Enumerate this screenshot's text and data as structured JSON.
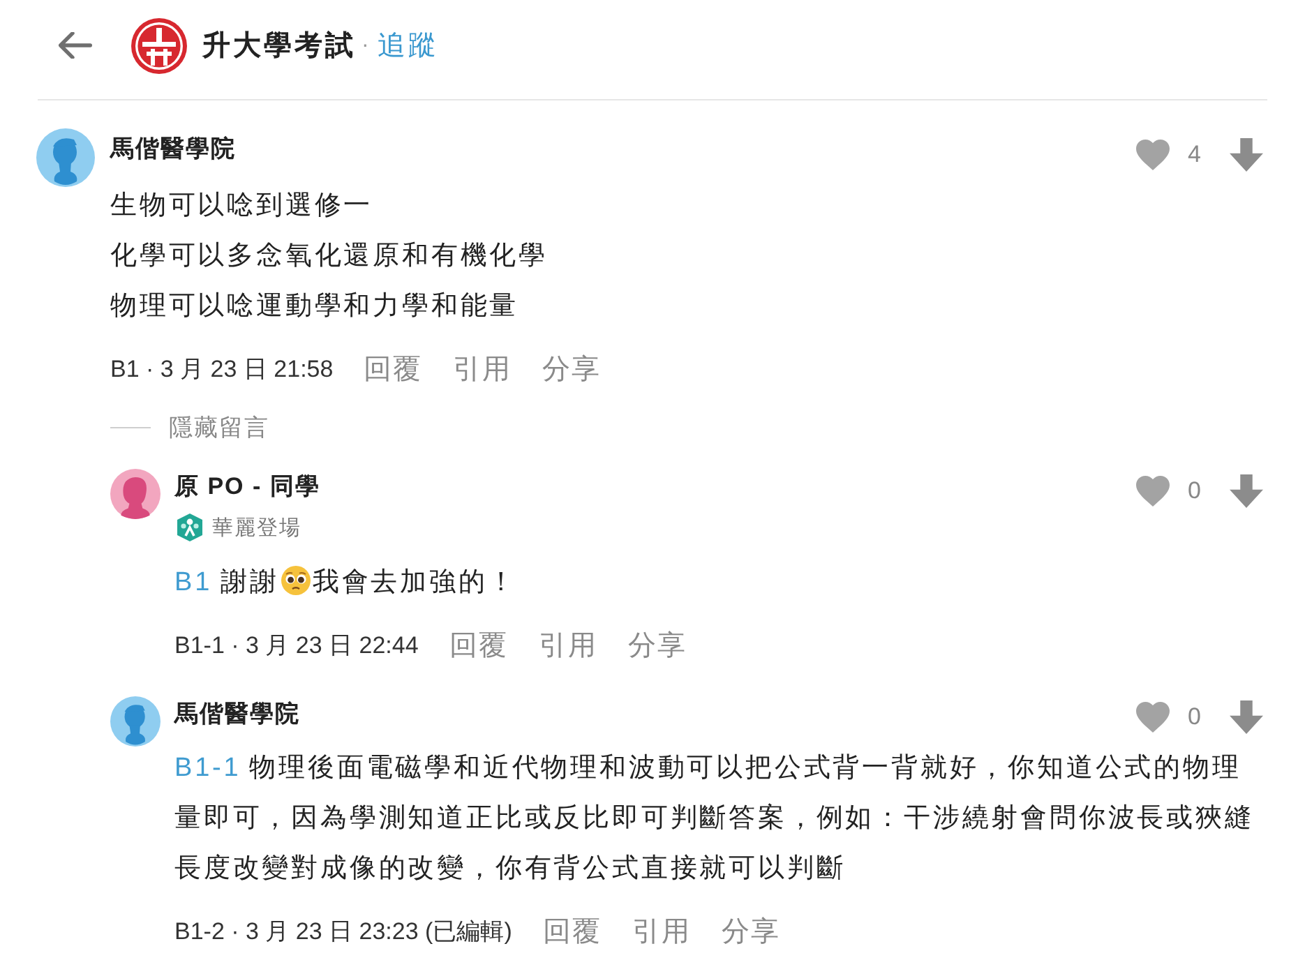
{
  "header": {
    "title": "升大學考試",
    "separator": "·",
    "follow": "追蹤"
  },
  "comments": [
    {
      "author": "馬偕醫學院",
      "avatar": {
        "kind": "male"
      },
      "liked": false,
      "likes": "4",
      "body": [
        [
          {
            "kind": "text",
            "text": "生物可以唸到選修一"
          }
        ],
        [
          {
            "kind": "text",
            "text": "化學可以多念氧化還原和有機化學"
          }
        ],
        [
          {
            "kind": "text",
            "text": "物理可以唸運動學和力學和能量"
          }
        ]
      ],
      "meta": "B1 · 3 月 23 日 21:58",
      "actions": [
        "回覆",
        "引用",
        "分享"
      ],
      "hidden_toggle": "隱藏留言",
      "replies": [
        {
          "author": "原 PO - 同學",
          "avatar": {
            "kind": "female"
          },
          "badge": "華麗登場",
          "liked": false,
          "likes": "0",
          "body": [
            [
              {
                "kind": "ref",
                "text": "B1"
              },
              {
                "kind": "text",
                "text": "謝謝"
              },
              {
                "kind": "emoji"
              },
              {
                "kind": "text",
                "text": "我會去加強的！"
              }
            ]
          ],
          "meta": "B1-1 · 3 月 23 日 22:44",
          "actions": [
            "回覆",
            "引用",
            "分享"
          ]
        },
        {
          "author": "馬偕醫學院",
          "avatar": {
            "kind": "male"
          },
          "liked": false,
          "likes": "0",
          "body": [
            [
              {
                "kind": "ref",
                "text": "B1-1"
              },
              {
                "kind": "text",
                "text": "物理後面電磁學和近代物理和波動可以把公式背一背就好，你知道公式的物理量即可，因為學測知道正比或反比即可判斷答案，例如：干涉繞射會問你波長或狹縫長度改變對成像的改變，你有背公式直接就可以判斷"
              }
            ]
          ],
          "meta": "B1-2 · 3 月 23 日 23:23 (已編輯)",
          "actions": [
            "回覆",
            "引用",
            "分享"
          ]
        }
      ]
    }
  ]
}
